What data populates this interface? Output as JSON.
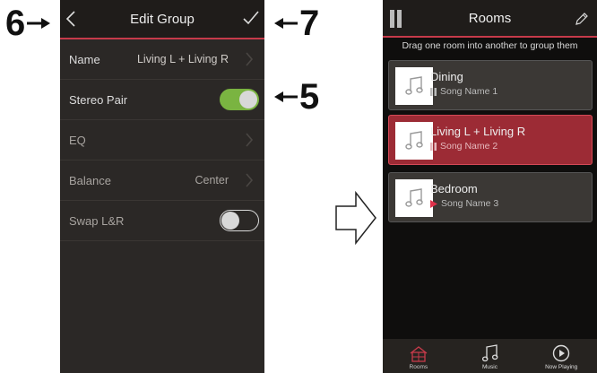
{
  "callouts": {
    "back": "6",
    "confirm": "7",
    "stereo": "5"
  },
  "edit_group": {
    "title": "Edit Group",
    "rows": [
      {
        "label": "Name",
        "value": "Living L + Living R"
      },
      {
        "label": "Stereo Pair",
        "toggle": true
      },
      {
        "label": "EQ"
      },
      {
        "label": "Balance",
        "value": "Center"
      },
      {
        "label": "Swap L&R",
        "toggle": false
      }
    ]
  },
  "rooms_screen": {
    "title": "Rooms",
    "instruction": "Drag one room into another to group them",
    "rooms": [
      {
        "name": "Dining",
        "song": "Song Name 1",
        "state": "paused"
      },
      {
        "name": "Living L + Living R",
        "song": "Song Name 2",
        "state": "paused"
      },
      {
        "name": "Bedroom",
        "song": "Song Name 3",
        "state": "playing"
      }
    ],
    "tabs": [
      {
        "label": "Rooms",
        "icon": "house-icon"
      },
      {
        "label": "Music",
        "icon": "music-note-icon"
      },
      {
        "label": "Now Playing",
        "icon": "play-circle-icon"
      }
    ]
  },
  "colors": {
    "accent": "#c63a4a",
    "toggle_on": "#7ab441",
    "selected_room": "#9c2b35",
    "playing_indicator": "#e0304a"
  }
}
